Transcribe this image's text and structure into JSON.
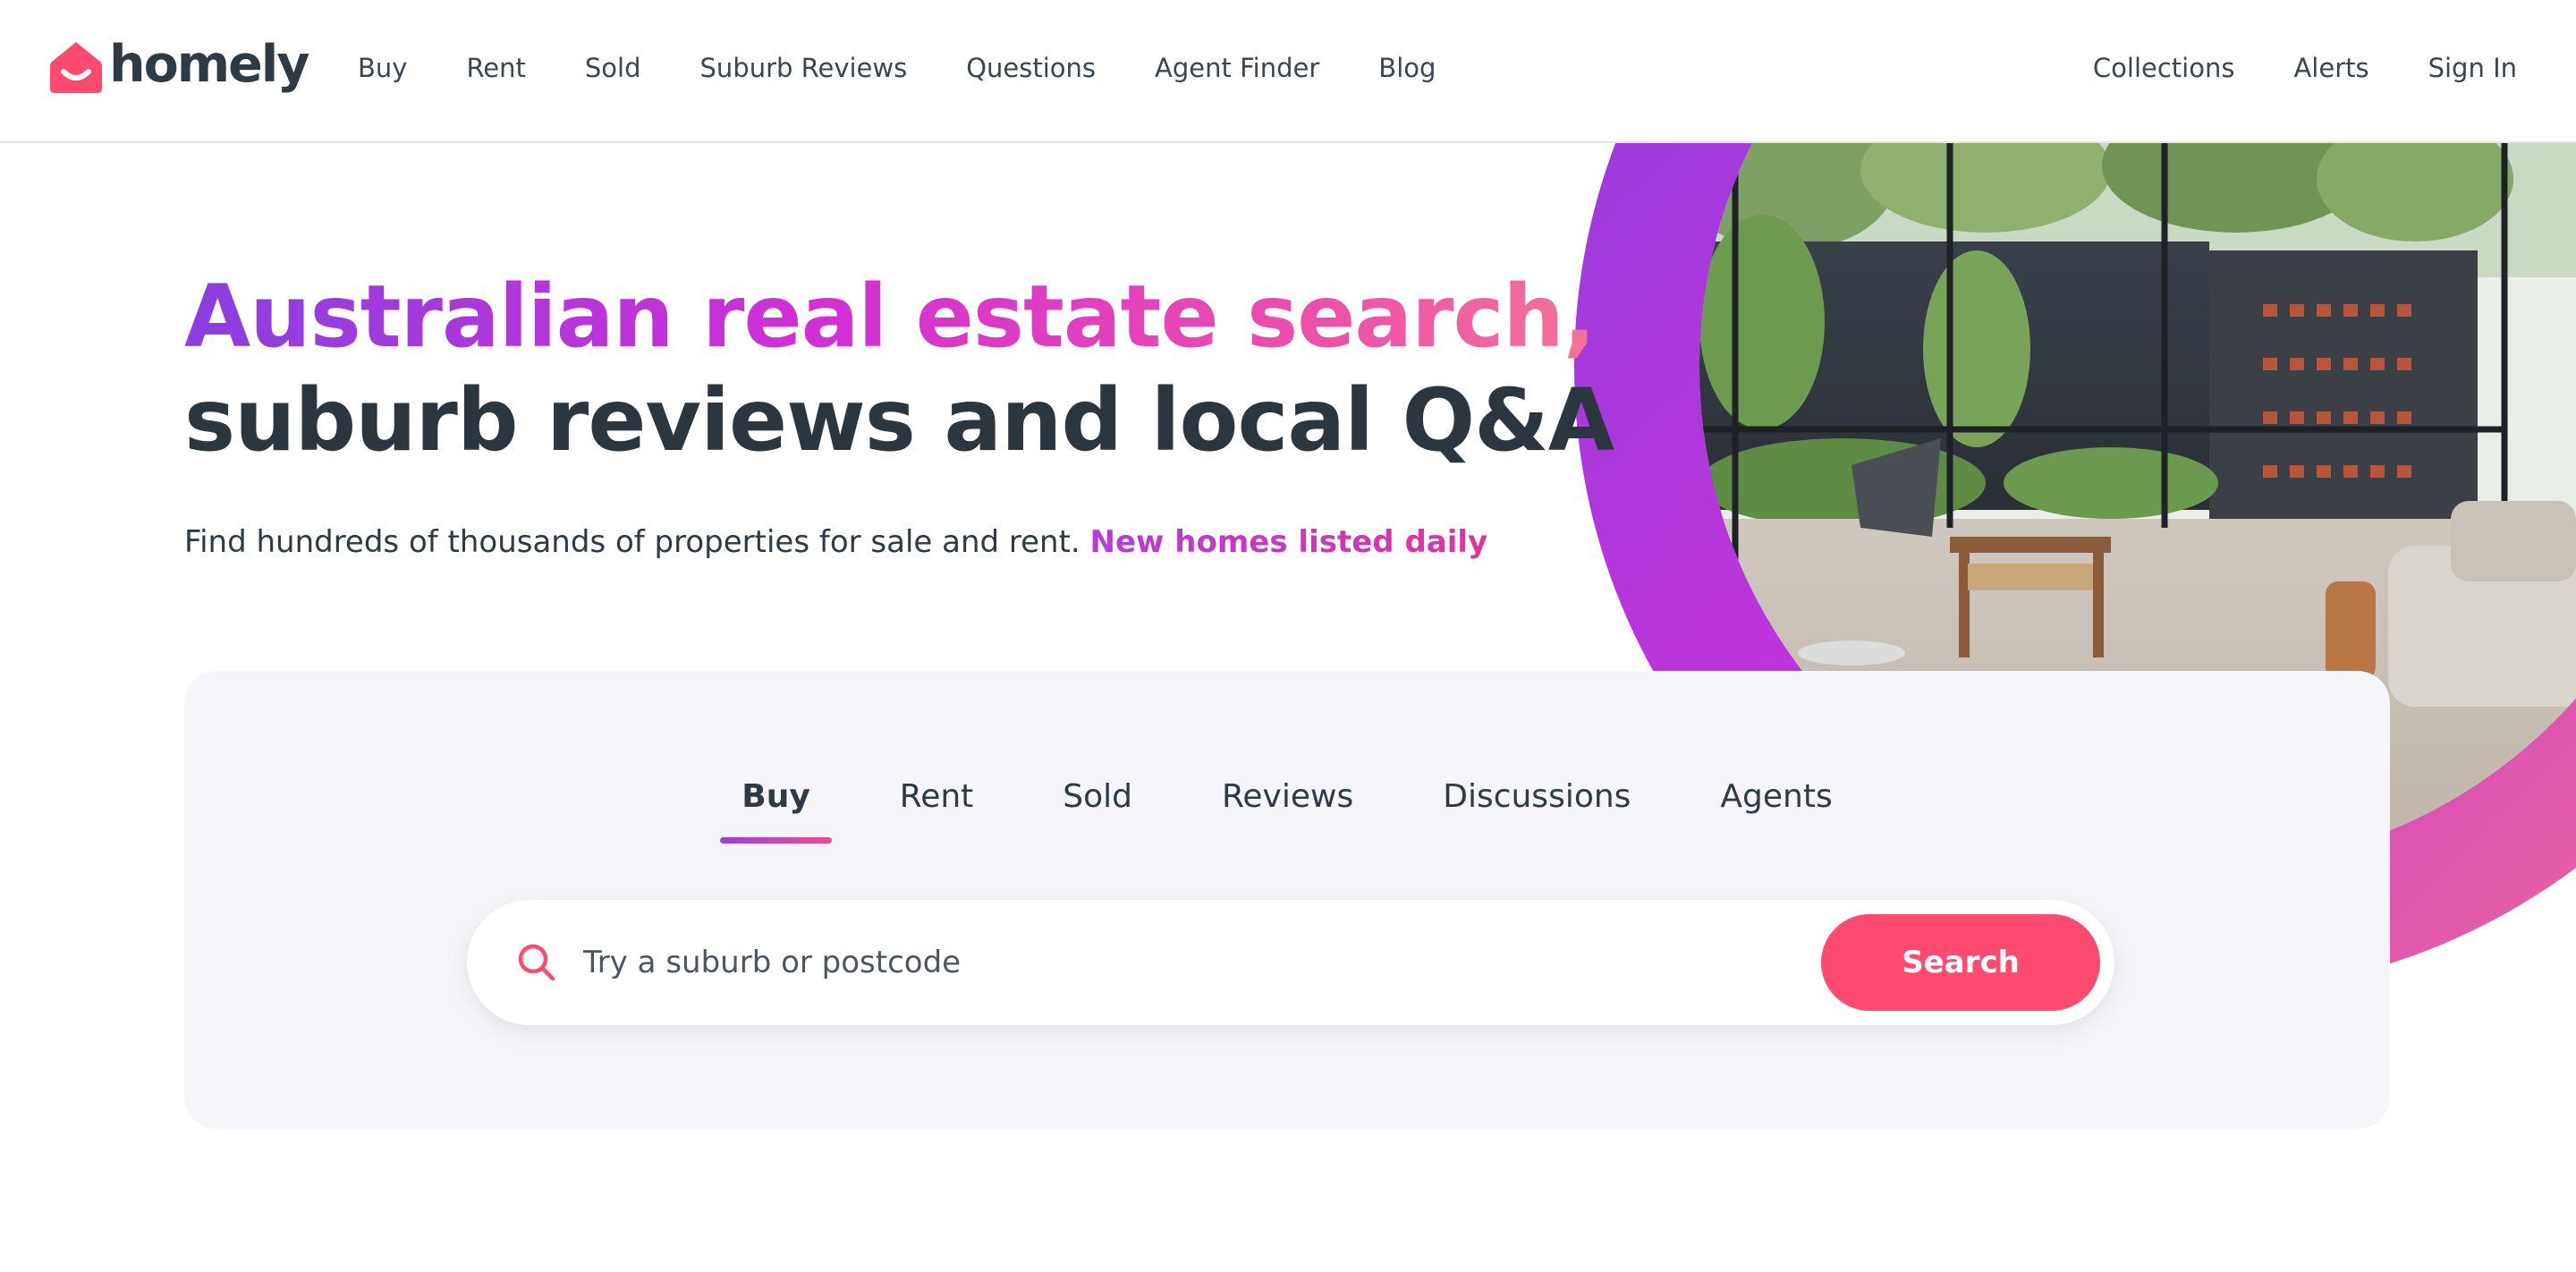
{
  "brand": {
    "name": "homely",
    "logo_icon": "house-smile-icon",
    "color": "#fd4a6e"
  },
  "nav": {
    "items": [
      {
        "label": "Buy"
      },
      {
        "label": "Rent"
      },
      {
        "label": "Sold"
      },
      {
        "label": "Suburb Reviews"
      },
      {
        "label": "Questions"
      },
      {
        "label": "Agent Finder"
      },
      {
        "label": "Blog"
      }
    ],
    "right_items": [
      {
        "label": "Collections"
      },
      {
        "label": "Alerts"
      },
      {
        "label": "Sign In"
      }
    ]
  },
  "hero": {
    "title_highlight": "Australian real estate search,",
    "title_rest": "suburb reviews and local Q&A",
    "subtitle": "Find hundreds of thousands of properties for sale and rent. ",
    "subtitle_accent": "New homes listed daily",
    "gradient_colors": [
      "#8a3fe0",
      "#d22fd6",
      "#f27398"
    ]
  },
  "search": {
    "tabs": [
      {
        "label": "Buy",
        "active": true
      },
      {
        "label": "Rent",
        "active": false
      },
      {
        "label": "Sold",
        "active": false
      },
      {
        "label": "Reviews",
        "active": false
      },
      {
        "label": "Discussions",
        "active": false
      },
      {
        "label": "Agents",
        "active": false
      }
    ],
    "placeholder": "Try a suburb or postcode",
    "value": "",
    "button_label": "Search",
    "icon": "search-icon",
    "button_color": "#fd4a6e"
  }
}
